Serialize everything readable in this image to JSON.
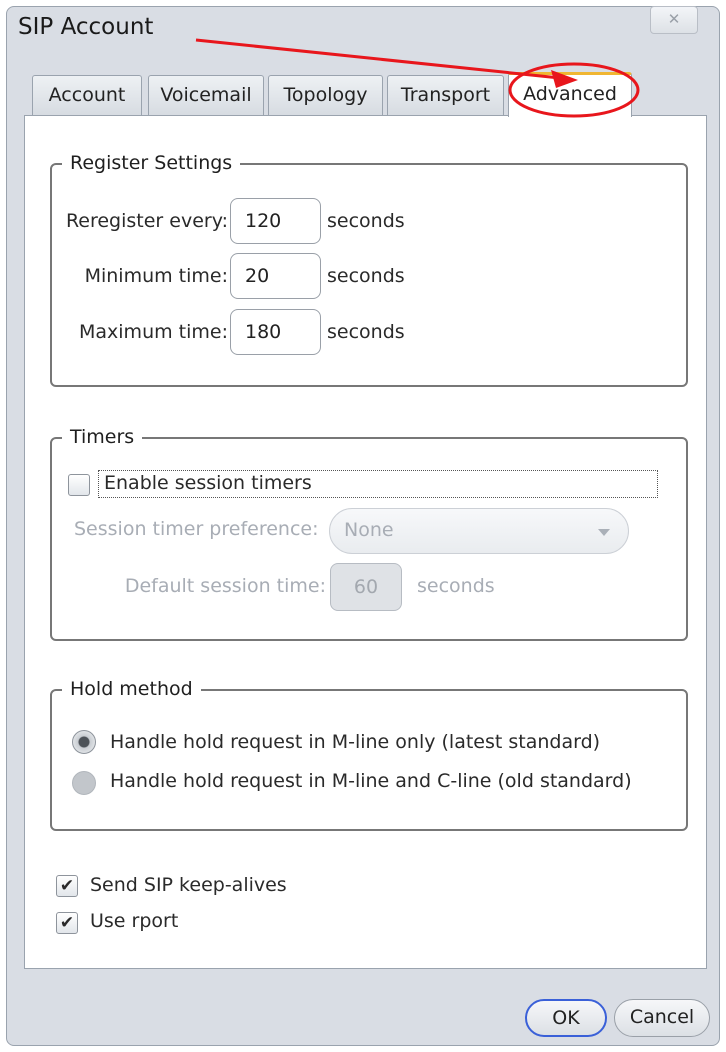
{
  "window": {
    "title": "SIP Account",
    "close_glyph": "✕"
  },
  "tabs": [
    {
      "label": "Account"
    },
    {
      "label": "Voicemail"
    },
    {
      "label": "Topology"
    },
    {
      "label": "Transport"
    },
    {
      "label": "Advanced",
      "active": true
    }
  ],
  "register": {
    "legend": "Register Settings",
    "rows": [
      {
        "label": "Reregister every:",
        "value": "120",
        "unit": "seconds"
      },
      {
        "label": "Minimum time:",
        "value": "20",
        "unit": "seconds"
      },
      {
        "label": "Maximum time:",
        "value": "180",
        "unit": "seconds"
      }
    ]
  },
  "timers": {
    "legend": "Timers",
    "enable_label": "Enable session timers",
    "enable_checked": false,
    "preference_label": "Session timer preference:",
    "preference_value": "None",
    "default_label": "Default session time:",
    "default_value": "60",
    "default_unit": "seconds"
  },
  "hold": {
    "legend": "Hold method",
    "options": [
      {
        "label": "Handle hold request in M-line only (latest standard)",
        "selected": true
      },
      {
        "label": "Handle hold request in M-line and C-line (old standard)",
        "selected": false
      }
    ]
  },
  "options": {
    "keepalive_label": "Send SIP keep-alives",
    "keepalive_checked": true,
    "rport_label": "Use rport",
    "rport_checked": true,
    "check_glyph": "✔"
  },
  "footer": {
    "ok_label": "OK",
    "cancel_label": "Cancel"
  },
  "annotation": {
    "color": "#e8161c"
  }
}
